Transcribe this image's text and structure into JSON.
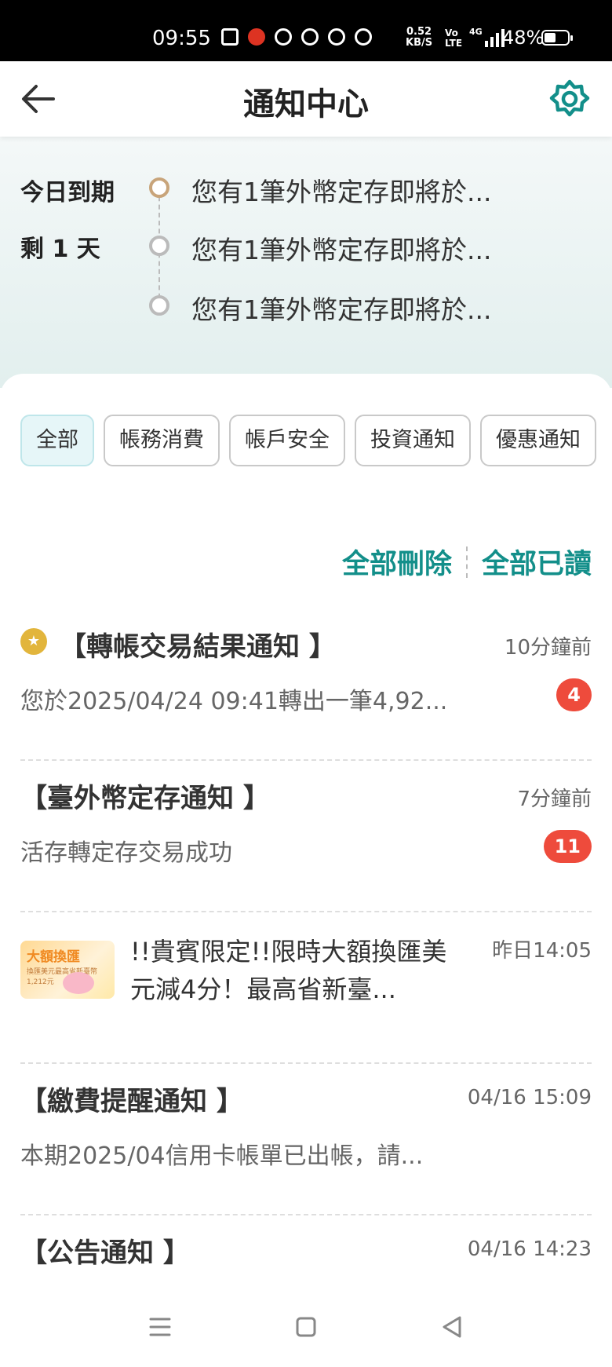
{
  "status_bar": {
    "time": "09:55",
    "net_speed_value": "0.52",
    "net_speed_unit": "KB/S",
    "volte_top": "Vo",
    "volte_bottom": "LTE",
    "signal_type": "4G",
    "battery": "48%"
  },
  "header": {
    "title": "通知中心",
    "back_icon": "arrow-left-icon",
    "settings_icon": "gear-icon",
    "accent_color": "#138f8a"
  },
  "expiry": {
    "labels": [
      "今日到期",
      "剩 1 天"
    ],
    "items": [
      {
        "text": "您有1筆外幣定存即將於..."
      },
      {
        "text": "您有1筆外幣定存即將於..."
      },
      {
        "text": "您有1筆外幣定存即將於..."
      }
    ]
  },
  "tabs": [
    {
      "label": "全部",
      "active": true
    },
    {
      "label": "帳務消費",
      "active": false
    },
    {
      "label": "帳戶安全",
      "active": false
    },
    {
      "label": "投資通知",
      "active": false
    },
    {
      "label": "優惠通知",
      "active": false
    }
  ],
  "actions": {
    "delete_all": "全部刪除",
    "read_all": "全部已讀"
  },
  "notifications": [
    {
      "title": "【轉帳交易結果通知 】",
      "time": "10分鐘前",
      "body": "您於2025/04/24 09:41轉出一筆4,92...",
      "badge": "4",
      "pinned": true
    },
    {
      "title": "【臺外幣定存通知 】",
      "time": "7分鐘前",
      "body": "活存轉定存交易成功",
      "badge": "11"
    },
    {
      "title": "!!貴賓限定!!限時大額換匯美元減4分！最高省新臺...",
      "time": "昨日14:05",
      "thumb_title": "大額換匯",
      "thumb_sub": "換匯美元最高省新臺幣1,212元"
    },
    {
      "title": "【繳費提醒通知 】",
      "time": "04/16 15:09",
      "body": "本期2025/04信用卡帳單已出帳，請..."
    },
    {
      "title": "【公告通知 】",
      "time": "04/16 14:23"
    }
  ],
  "nav": {
    "menu_icon": "menu-icon",
    "home_icon": "home-icon",
    "back_icon": "back-triangle-icon"
  }
}
